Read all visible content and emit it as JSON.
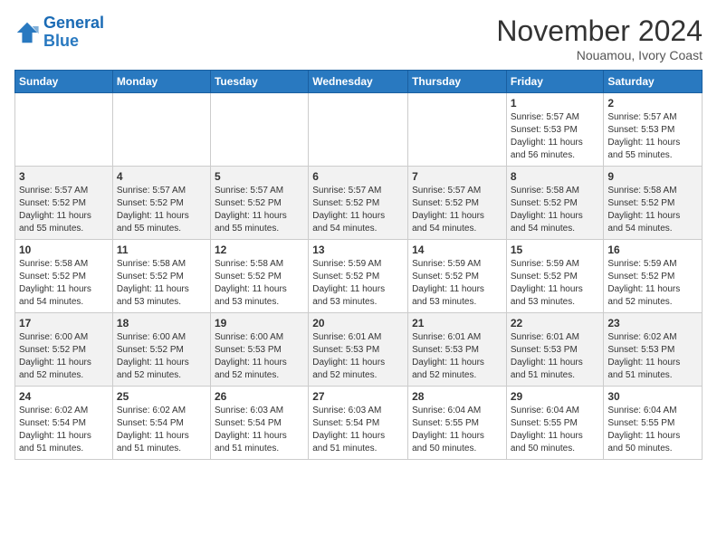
{
  "header": {
    "logo_line1": "General",
    "logo_line2": "Blue",
    "month": "November 2024",
    "location": "Nouamou, Ivory Coast"
  },
  "weekdays": [
    "Sunday",
    "Monday",
    "Tuesday",
    "Wednesday",
    "Thursday",
    "Friday",
    "Saturday"
  ],
  "weeks": [
    [
      {
        "day": "",
        "info": ""
      },
      {
        "day": "",
        "info": ""
      },
      {
        "day": "",
        "info": ""
      },
      {
        "day": "",
        "info": ""
      },
      {
        "day": "",
        "info": ""
      },
      {
        "day": "1",
        "info": "Sunrise: 5:57 AM\nSunset: 5:53 PM\nDaylight: 11 hours\nand 56 minutes."
      },
      {
        "day": "2",
        "info": "Sunrise: 5:57 AM\nSunset: 5:53 PM\nDaylight: 11 hours\nand 55 minutes."
      }
    ],
    [
      {
        "day": "3",
        "info": "Sunrise: 5:57 AM\nSunset: 5:52 PM\nDaylight: 11 hours\nand 55 minutes."
      },
      {
        "day": "4",
        "info": "Sunrise: 5:57 AM\nSunset: 5:52 PM\nDaylight: 11 hours\nand 55 minutes."
      },
      {
        "day": "5",
        "info": "Sunrise: 5:57 AM\nSunset: 5:52 PM\nDaylight: 11 hours\nand 55 minutes."
      },
      {
        "day": "6",
        "info": "Sunrise: 5:57 AM\nSunset: 5:52 PM\nDaylight: 11 hours\nand 54 minutes."
      },
      {
        "day": "7",
        "info": "Sunrise: 5:57 AM\nSunset: 5:52 PM\nDaylight: 11 hours\nand 54 minutes."
      },
      {
        "day": "8",
        "info": "Sunrise: 5:58 AM\nSunset: 5:52 PM\nDaylight: 11 hours\nand 54 minutes."
      },
      {
        "day": "9",
        "info": "Sunrise: 5:58 AM\nSunset: 5:52 PM\nDaylight: 11 hours\nand 54 minutes."
      }
    ],
    [
      {
        "day": "10",
        "info": "Sunrise: 5:58 AM\nSunset: 5:52 PM\nDaylight: 11 hours\nand 54 minutes."
      },
      {
        "day": "11",
        "info": "Sunrise: 5:58 AM\nSunset: 5:52 PM\nDaylight: 11 hours\nand 53 minutes."
      },
      {
        "day": "12",
        "info": "Sunrise: 5:58 AM\nSunset: 5:52 PM\nDaylight: 11 hours\nand 53 minutes."
      },
      {
        "day": "13",
        "info": "Sunrise: 5:59 AM\nSunset: 5:52 PM\nDaylight: 11 hours\nand 53 minutes."
      },
      {
        "day": "14",
        "info": "Sunrise: 5:59 AM\nSunset: 5:52 PM\nDaylight: 11 hours\nand 53 minutes."
      },
      {
        "day": "15",
        "info": "Sunrise: 5:59 AM\nSunset: 5:52 PM\nDaylight: 11 hours\nand 53 minutes."
      },
      {
        "day": "16",
        "info": "Sunrise: 5:59 AM\nSunset: 5:52 PM\nDaylight: 11 hours\nand 52 minutes."
      }
    ],
    [
      {
        "day": "17",
        "info": "Sunrise: 6:00 AM\nSunset: 5:52 PM\nDaylight: 11 hours\nand 52 minutes."
      },
      {
        "day": "18",
        "info": "Sunrise: 6:00 AM\nSunset: 5:52 PM\nDaylight: 11 hours\nand 52 minutes."
      },
      {
        "day": "19",
        "info": "Sunrise: 6:00 AM\nSunset: 5:53 PM\nDaylight: 11 hours\nand 52 minutes."
      },
      {
        "day": "20",
        "info": "Sunrise: 6:01 AM\nSunset: 5:53 PM\nDaylight: 11 hours\nand 52 minutes."
      },
      {
        "day": "21",
        "info": "Sunrise: 6:01 AM\nSunset: 5:53 PM\nDaylight: 11 hours\nand 52 minutes."
      },
      {
        "day": "22",
        "info": "Sunrise: 6:01 AM\nSunset: 5:53 PM\nDaylight: 11 hours\nand 51 minutes."
      },
      {
        "day": "23",
        "info": "Sunrise: 6:02 AM\nSunset: 5:53 PM\nDaylight: 11 hours\nand 51 minutes."
      }
    ],
    [
      {
        "day": "24",
        "info": "Sunrise: 6:02 AM\nSunset: 5:54 PM\nDaylight: 11 hours\nand 51 minutes."
      },
      {
        "day": "25",
        "info": "Sunrise: 6:02 AM\nSunset: 5:54 PM\nDaylight: 11 hours\nand 51 minutes."
      },
      {
        "day": "26",
        "info": "Sunrise: 6:03 AM\nSunset: 5:54 PM\nDaylight: 11 hours\nand 51 minutes."
      },
      {
        "day": "27",
        "info": "Sunrise: 6:03 AM\nSunset: 5:54 PM\nDaylight: 11 hours\nand 51 minutes."
      },
      {
        "day": "28",
        "info": "Sunrise: 6:04 AM\nSunset: 5:55 PM\nDaylight: 11 hours\nand 50 minutes."
      },
      {
        "day": "29",
        "info": "Sunrise: 6:04 AM\nSunset: 5:55 PM\nDaylight: 11 hours\nand 50 minutes."
      },
      {
        "day": "30",
        "info": "Sunrise: 6:04 AM\nSunset: 5:55 PM\nDaylight: 11 hours\nand 50 minutes."
      }
    ]
  ]
}
